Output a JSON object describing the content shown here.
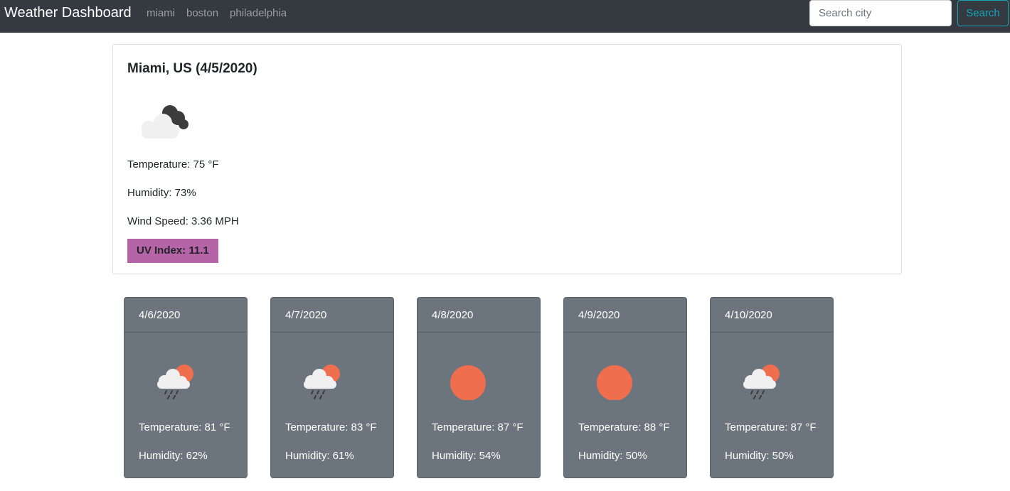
{
  "nav": {
    "brand": "Weather Dashboard",
    "links": [
      "miami",
      "boston",
      "philadelphia"
    ],
    "search_placeholder": "Search city",
    "search_button": "Search"
  },
  "current": {
    "title": "Miami, US (4/5/2020)",
    "icon": "cloudy-night-icon",
    "temperature": "Temperature: 75 °F",
    "humidity": "Humidity: 73%",
    "wind": "Wind Speed: 3.36 MPH",
    "uv": "UV Index: 11.1",
    "uv_color": "#b565a7"
  },
  "forecast": [
    {
      "date": "4/6/2020",
      "icon": "rain-sun-icon",
      "temp": "Temperature: 81 °F",
      "humidity": "Humidity: 62%"
    },
    {
      "date": "4/7/2020",
      "icon": "rain-sun-icon",
      "temp": "Temperature: 83 °F",
      "humidity": "Humidity: 61%"
    },
    {
      "date": "4/8/2020",
      "icon": "sun-icon",
      "temp": "Temperature: 87 °F",
      "humidity": "Humidity: 54%"
    },
    {
      "date": "4/9/2020",
      "icon": "sun-icon",
      "temp": "Temperature: 88 °F",
      "humidity": "Humidity: 50%"
    },
    {
      "date": "4/10/2020",
      "icon": "rain-sun-icon",
      "temp": "Temperature: 87 °F",
      "humidity": "Humidity: 50%"
    }
  ],
  "colors": {
    "navbar": "#343a40",
    "accent": "#17a2b8",
    "forecast_card": "#6c757d",
    "sun": "#ee6e4d"
  }
}
